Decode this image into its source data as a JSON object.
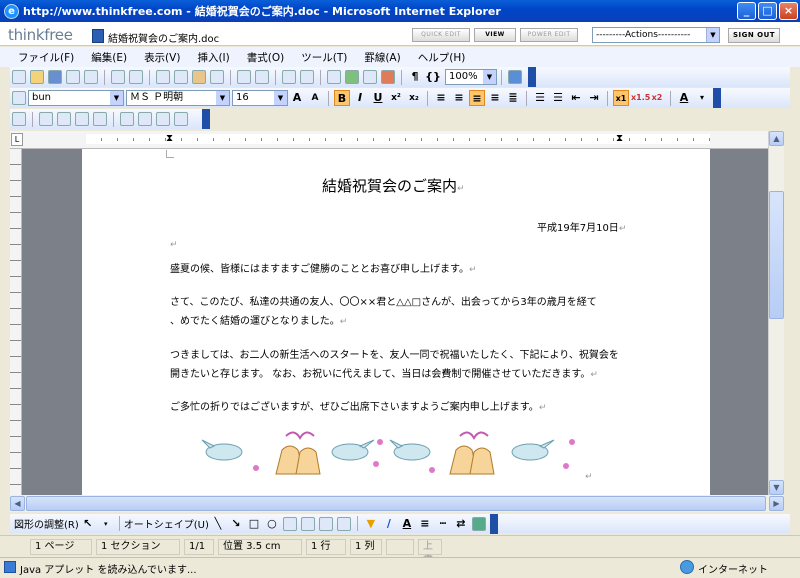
{
  "window": {
    "title": "http://www.thinkfree.com - 結婚祝賀会のご案内.doc - Microsoft Internet Explorer"
  },
  "app": {
    "logo": "thinkfree",
    "doc_name": "結婚祝賀会のご案内.doc",
    "buttons": {
      "quick_edit": "QUICK EDIT",
      "view": "VIEW",
      "power_edit": "POWER EDIT",
      "sign_out": "SIGN OUT"
    },
    "actions_select": "---------Actions----------"
  },
  "menu": [
    "ファイル(F)",
    "編集(E)",
    "表示(V)",
    "挿入(I)",
    "書式(O)",
    "ツール(T)",
    "罫線(A)",
    "ヘルプ(H)"
  ],
  "toolbar": {
    "zoom": "100%"
  },
  "format": {
    "style": "bun",
    "font": "ＭＳ Ｐ明朝",
    "size": "16"
  },
  "document": {
    "title": "結婚祝賀会のご案内",
    "date": "平成19年7月10日",
    "paragraphs": [
      "盛夏の候、皆様にはますますご健勝のこととお喜び申し上げます。",
      "さて、このたび、私達の共通の友人、〇〇××君と△△□さんが、出会ってから3年の歳月を経て",
      "、めでたく結婚の運びとなりました。",
      "つきましては、お二人の新生活へのスタートを、友人一同で祝福いたしたく、下記により、祝賀会を",
      "開きたいと存じます。 なお、お祝いに代えまして、当日は会費制で開催させていただきます。",
      "ご多忙の折りではございますが、ぜひご出席下さいますようご案内申し上げます。"
    ],
    "para_mark": "↵"
  },
  "drawing": {
    "shapes_menu": "図形の調整(R)",
    "autoshape": "オートシェイプ(U)"
  },
  "status": {
    "page": "1 ページ",
    "section": "1 セクション",
    "pages": "1/1",
    "position": "位置 3.5 cm",
    "line": "1 行",
    "column": "1 列",
    "overwrite": "上書"
  },
  "ie_status": {
    "message": "Java アプレット を読み込んでいます...",
    "zone": "インターネット"
  }
}
